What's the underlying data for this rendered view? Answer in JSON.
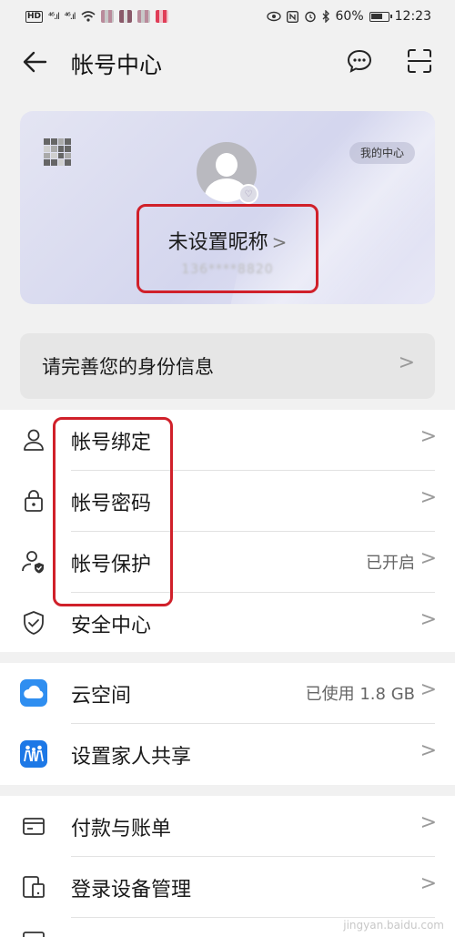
{
  "status_bar": {
    "hd": "HD",
    "sig1": "⁴⁶.ıl",
    "sig2": "⁴⁶.ıl",
    "battery_pct": "60%",
    "time": "12:23"
  },
  "header": {
    "title": "帐号中心"
  },
  "profile": {
    "my_center_label": "我的中心",
    "nickname": "未设置昵称",
    "phone": "136****8820"
  },
  "identity_banner": {
    "label": "请完善您的身份信息"
  },
  "account_group": [
    {
      "label": "帐号绑定",
      "value": ""
    },
    {
      "label": "帐号密码",
      "value": ""
    },
    {
      "label": "帐号保护",
      "value": "已开启"
    },
    {
      "label": "安全中心",
      "value": ""
    }
  ],
  "cloud_group": [
    {
      "label": "云空间",
      "value": "已使用 1.8 GB"
    },
    {
      "label": "设置家人共享",
      "value": ""
    }
  ],
  "more_group": [
    {
      "label": "付款与账单",
      "value": ""
    },
    {
      "label": "登录设备管理",
      "value": ""
    }
  ],
  "watermark": "jingyan.baidu.com",
  "colors": {
    "highlight_box": "#d0202a",
    "cloud_blue": "#2f8ef0",
    "family_blue": "#1d78e6"
  }
}
